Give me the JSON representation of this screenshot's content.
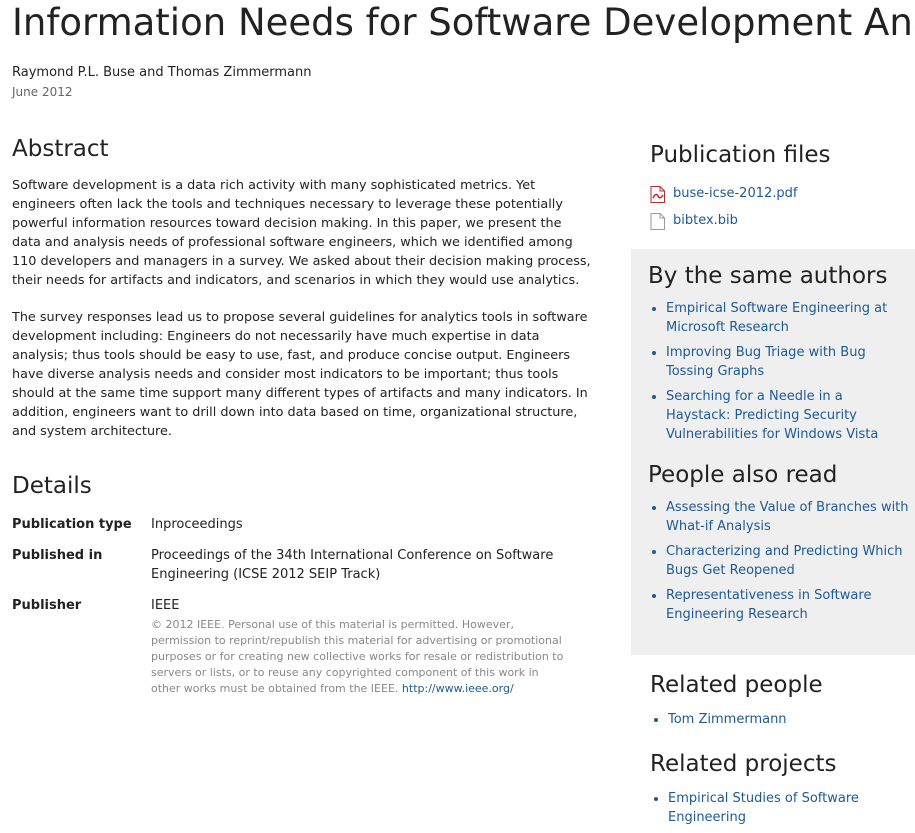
{
  "title": "Information Needs for Software Development Analytics",
  "authors": "Raymond P.L. Buse and Thomas Zimmermann",
  "date": "June 2012",
  "abstract": {
    "heading": "Abstract",
    "paragraphs": [
      "Software development is a data rich activity with many sophisticated metrics. Yet engineers often lack the tools and techniques necessary to leverage these potentially powerful information resources toward decision making. In this paper, we present the data and analysis needs of professional software engineers, which we identified among 110 developers and managers in a survey. We asked about their decision making process, their needs for artifacts and indicators, and scenarios in which they would use analytics.",
      "The survey responses lead us to propose several guidelines for analytics tools in software development including: Engineers do not necessarily have much expertise in data analysis; thus tools should be easy to use, fast, and produce concise output. Engineers have diverse analysis needs and consider most indicators to be important; thus tools should at the same time support many different types of artifacts and many indicators. In addition, engineers want to drill down into data based on time, organizational structure, and system architecture."
    ]
  },
  "details": {
    "heading": "Details",
    "rows": [
      {
        "key": "Publication type",
        "value": "Inproceedings"
      },
      {
        "key": "Published in",
        "value": "Proceedings of the 34th International Conference on Software Engineering (ICSE 2012 SEIP Track)"
      },
      {
        "key": "Publisher",
        "value": "IEEE"
      }
    ],
    "copyright_text": "© 2012 IEEE. Personal use of this material is permitted. However, permission to reprint/republish this material for advertising or promotional purposes or for creating new collective works for resale or redistribution to servers or lists, or to reuse any copyrighted component of this work in other works must be obtained from the IEEE.",
    "copyright_link": "http://www.ieee.org/"
  },
  "publication_files": {
    "heading": "Publication files",
    "files": [
      {
        "name": "buse-icse-2012.pdf",
        "icon": "pdf-file-icon"
      },
      {
        "name": "bibtex.bib",
        "icon": "text-file-icon"
      }
    ]
  },
  "same_authors": {
    "heading": "By the same authors",
    "items": [
      "Empirical Software Engineering at Microsoft Research",
      "Improving Bug Triage with Bug Tossing Graphs",
      "Searching for a Needle in a Haystack: Predicting Security Vulnerabilities for Windows Vista"
    ]
  },
  "also_read": {
    "heading": "People also read",
    "items": [
      "Assessing the Value of Branches with What-if Analysis",
      "Characterizing and Predicting Which Bugs Get Reopened",
      "Representativeness in Software Engineering Research"
    ]
  },
  "related_people": {
    "heading": "Related people",
    "items": [
      "Tom Zimmermann"
    ]
  },
  "related_projects": {
    "heading": "Related projects",
    "items": [
      "Empirical Studies of Software Engineering"
    ]
  },
  "colors": {
    "link": "#1d5a95",
    "panel_bg": "#efefef",
    "muted_text": "#888888"
  }
}
